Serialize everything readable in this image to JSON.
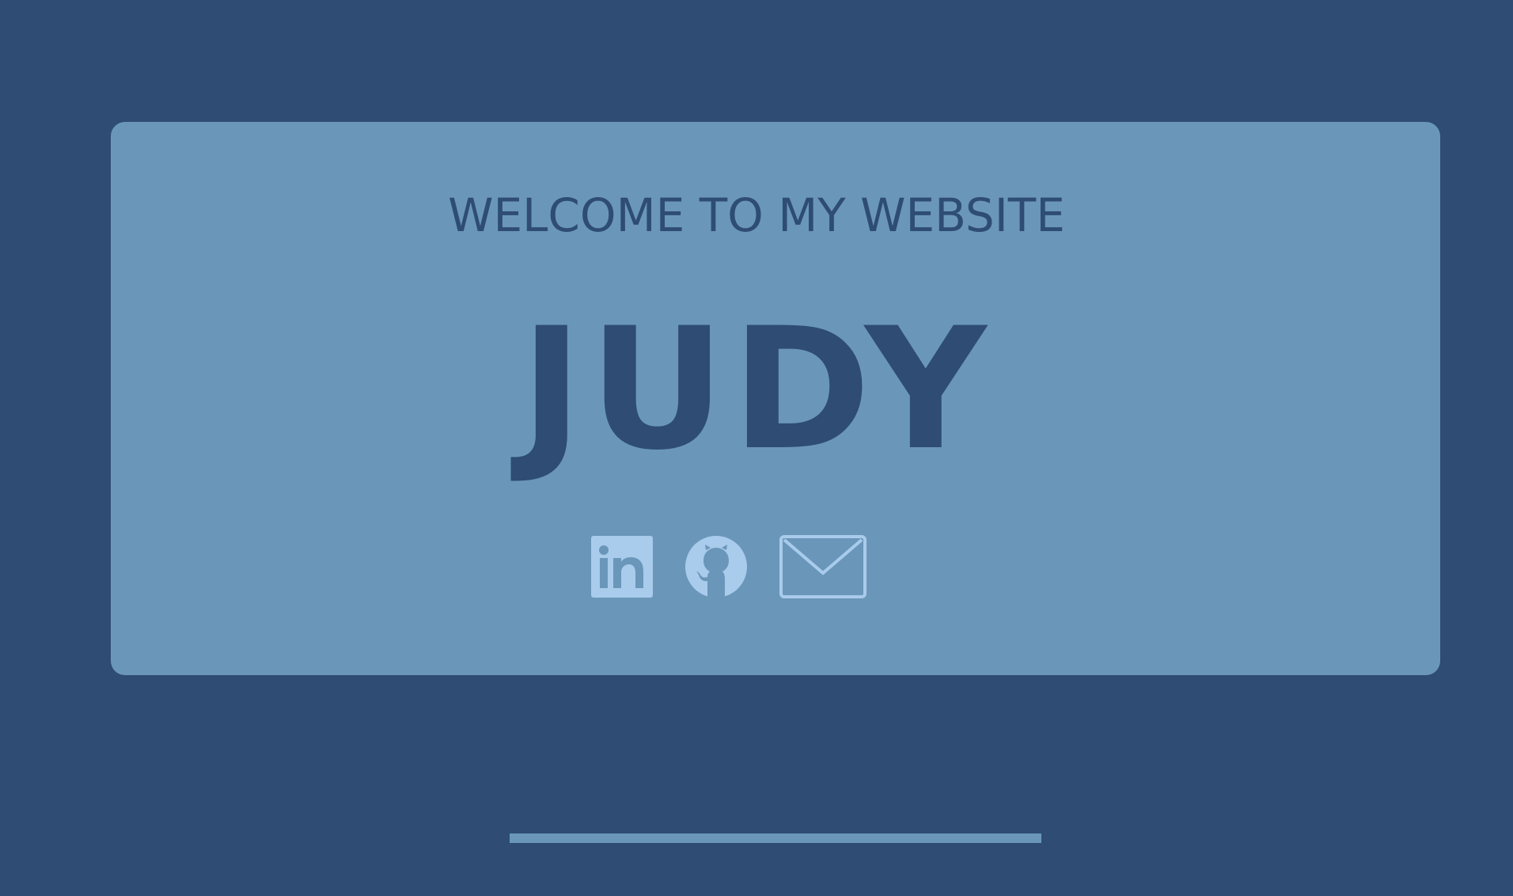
{
  "hero": {
    "welcome": "WELCOME TO MY WEBSITE",
    "name": "JUDY"
  },
  "socials": [
    {
      "icon": "linkedin-icon",
      "label": "LinkedIn"
    },
    {
      "icon": "github-icon",
      "label": "GitHub"
    },
    {
      "icon": "email-icon",
      "label": "Email"
    }
  ],
  "colors": {
    "background": "#2e4c74",
    "card": "#6a97b9",
    "icon": "#a9cbec",
    "text": "#2e4c74"
  }
}
